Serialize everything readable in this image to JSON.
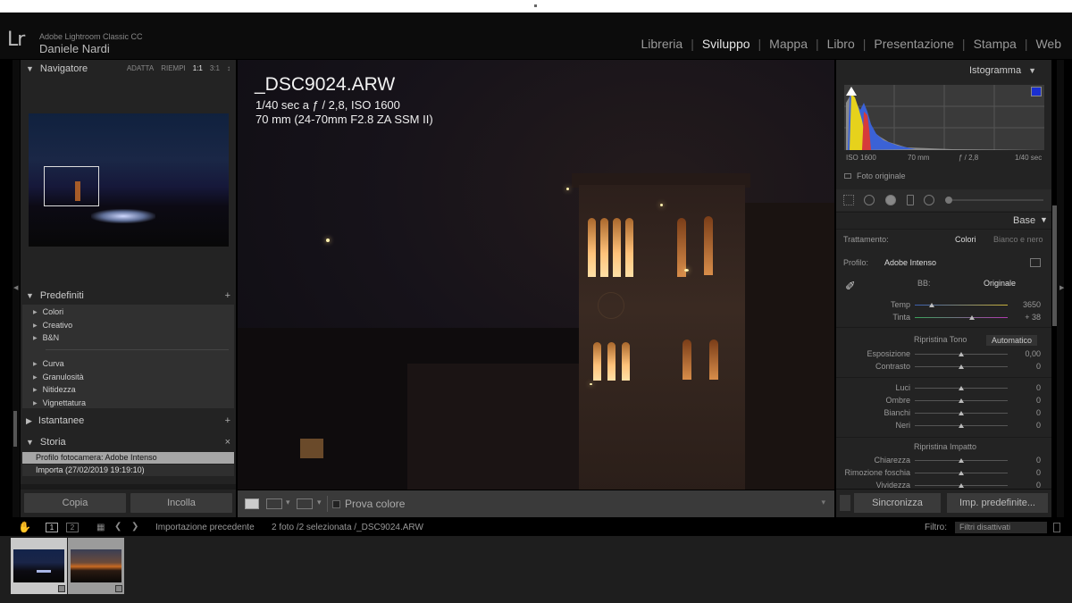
{
  "app": {
    "title": "Adobe Lightroom Classic CC",
    "logo": "Lr",
    "user": "Daniele Nardi"
  },
  "modules": [
    {
      "label": "Libreria",
      "active": false
    },
    {
      "label": "Sviluppo",
      "active": true
    },
    {
      "label": "Mappa",
      "active": false
    },
    {
      "label": "Libro",
      "active": false
    },
    {
      "label": "Presentazione",
      "active": false
    },
    {
      "label": "Stampa",
      "active": false
    },
    {
      "label": "Web",
      "active": false
    }
  ],
  "left": {
    "navigator": {
      "title": "Navigatore",
      "options": [
        "ADATTA",
        "RIEMPI",
        "1:1",
        "3:1"
      ],
      "active_option": "1:1",
      "more": "↕"
    },
    "presets": {
      "title": "Predefiniti",
      "add": "+",
      "items": [
        "Colori",
        "Creativo",
        "B&N",
        "Curva",
        "Granulosità",
        "Nitidezza",
        "Vignettatura"
      ]
    },
    "snapshots": {
      "title": "Istantanee",
      "add": "+"
    },
    "history": {
      "title": "Storia",
      "clear": "×",
      "items": [
        "Profilo fotocamera: Adobe Intenso",
        "Importa (27/02/2019 19:19:10)"
      ]
    },
    "copy_button": "Copia",
    "paste_button": "Incolla"
  },
  "photo": {
    "filename": "_DSC9024.ARW",
    "exposure": "1/40 sec a ƒ / 2,8, ISO 1600",
    "lens": "70 mm (24-70mm F2.8 ZA SSM II)"
  },
  "toolbar": {
    "soft_proof_label": "Prova colore"
  },
  "right": {
    "histogram": {
      "title": "Istogramma",
      "iso": "ISO 1600",
      "focal": "70 mm",
      "aperture": "ƒ / 2,8",
      "shutter": "1/40 sec",
      "original_photo": "Foto originale"
    },
    "basic": {
      "title": "Base",
      "treatment_label": "Trattamento:",
      "treatment_color": "Colori",
      "treatment_bw": "Bianco e nero",
      "profile_label": "Profilo:",
      "profile_value": "Adobe Intenso",
      "wb_label": "BB:",
      "wb_value": "Originale",
      "sliders": [
        {
          "label": "Temp",
          "value": "3650",
          "pos": 0.18
        },
        {
          "label": "Tinta",
          "value": "+ 38",
          "pos": 0.62
        },
        {
          "label": "Esposizione",
          "value": "0,00",
          "pos": 0.5
        },
        {
          "label": "Contrasto",
          "value": "0",
          "pos": 0.5
        },
        {
          "label": "Luci",
          "value": "0",
          "pos": 0.5
        },
        {
          "label": "Ombre",
          "value": "0",
          "pos": 0.5
        },
        {
          "label": "Bianchi",
          "value": "0",
          "pos": 0.5
        },
        {
          "label": "Neri",
          "value": "0",
          "pos": 0.5
        },
        {
          "label": "Chiarezza",
          "value": "0",
          "pos": 0.5
        },
        {
          "label": "Rimozione foschia",
          "value": "0",
          "pos": 0.5
        },
        {
          "label": "Vividezza",
          "value": "0",
          "pos": 0.5
        }
      ],
      "tone_label": "Ripristina Tono",
      "auto_label": "Automatico",
      "presence_label": "Ripristina Impatto"
    },
    "sync_button": "Sincronizza",
    "reset_button": "Imp. predefinite..."
  },
  "filmstrip": {
    "view1": "1",
    "view2": "2",
    "source": "Importazione precedente",
    "info": "2 foto /2 selezionata /_DSC9024.ARW",
    "filter_label": "Filtro:",
    "filter_value": "Filtri disattivati"
  }
}
